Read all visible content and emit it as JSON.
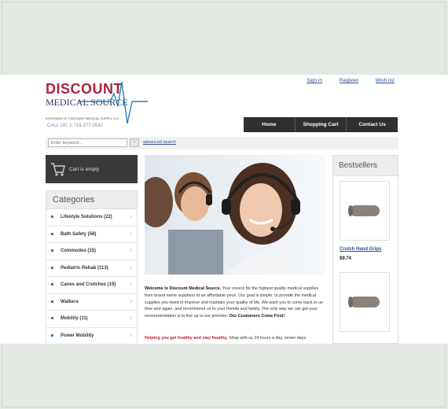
{
  "logo": {
    "line1": "DISCOUNT",
    "line2": "MEDICAL SOURCE",
    "tagline": "A DIVISION OF DISCOUNT MEDICAL SUPPLY LLC"
  },
  "call_us": "CALL US: 1-719-277-2542",
  "toplinks": {
    "signin": "Sign in",
    "register": "Register",
    "wishlist": "Wish list"
  },
  "nav": {
    "home": "Home",
    "shopping_cart": "Shopping Cart",
    "contact_us": "Contact Us"
  },
  "search": {
    "placeholder": "Enter keyword...",
    "advanced": "advanced search"
  },
  "cart": {
    "label": "Cart is empty"
  },
  "categories": {
    "title": "Categories",
    "items": [
      {
        "label": "Lifestyle Solutions (22)"
      },
      {
        "label": "Bath Safety (58)"
      },
      {
        "label": "Commodes (15)"
      },
      {
        "label": "Pediatric Rehab (113)"
      },
      {
        "label": "Canes and Crutches (19)"
      },
      {
        "label": "Walkers"
      },
      {
        "label": "Mobility (11)"
      },
      {
        "label": "Power Mobility"
      }
    ]
  },
  "welcome": {
    "title": "Welcome to Discount Medical Source.",
    "body": " Your source for the highest quality medical supplies from brand name suppliers at an affordable price. Our goal is simple: to provide the medical supplies you need to improve and maintain your quality of life. We want you to come back to us time and again, and recommend us to your friends and family. The only way we can get your recommendation is to live up to our promise: ",
    "promise": "Our Customers Come First!"
  },
  "helping": {
    "title": "Helping you get healthy and stay healthy.",
    "body": " Shop with us 24 hours a day, seven days"
  },
  "bestsellers": {
    "title": "Bestsellers",
    "products": [
      {
        "name": "Crutch Hand Grips",
        "price": "$9.74"
      }
    ]
  },
  "colors": {
    "brand_red": "#a8243b",
    "nav_dark": "#2f2f2f",
    "link_blue": "#2a4f9c",
    "background_band": "#e3e8e2"
  }
}
